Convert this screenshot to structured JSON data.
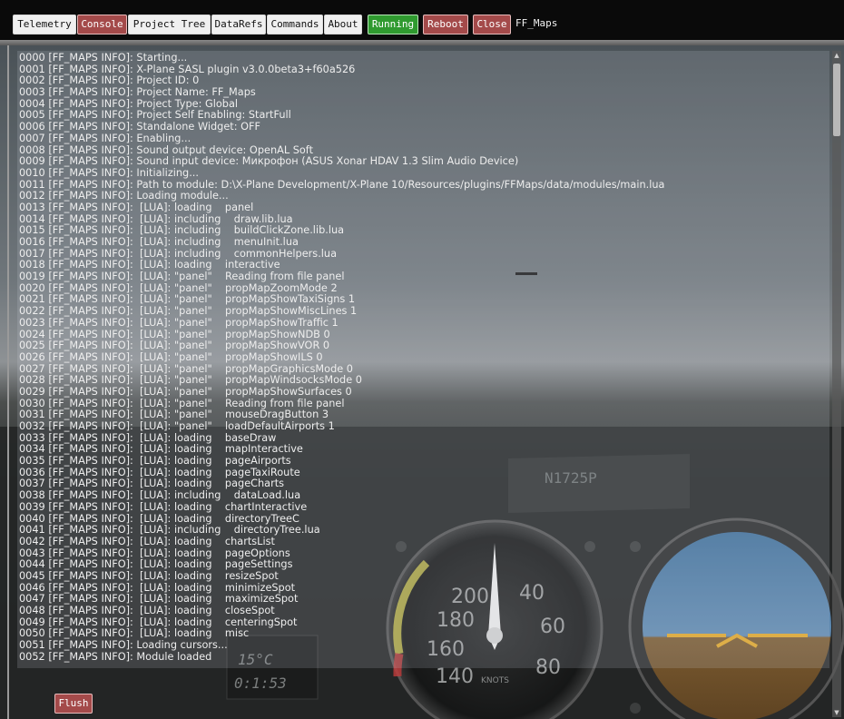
{
  "toolbar": {
    "tabs": [
      "Telemetry",
      "Console",
      "Project Tree",
      "DataRefs",
      "Commands",
      "About"
    ],
    "active_tab": "Console",
    "running_label": "Running",
    "reboot_label": "Reboot",
    "close_label": "Close",
    "plugin_name": "FF_Maps"
  },
  "console": {
    "flush_label": "Flush",
    "lines": [
      "0000 [FF_MAPS INFO]: Starting...",
      "0001 [FF_MAPS INFO]: X-Plane SASL plugin v3.0.0beta3+f60a526",
      "0002 [FF_MAPS INFO]: Project ID: 0",
      "0003 [FF_MAPS INFO]: Project Name: FF_Maps",
      "0004 [FF_MAPS INFO]: Project Type: Global",
      "0005 [FF_MAPS INFO]: Project Self Enabling: StartFull",
      "0006 [FF_MAPS INFO]: Standalone Widget: OFF",
      "0007 [FF_MAPS INFO]: Enabling...",
      "0008 [FF_MAPS INFO]: Sound output device: OpenAL Soft",
      "0009 [FF_MAPS INFO]: Sound input device: Микрофон (ASUS Xonar HDAV 1.3 Slim Audio Device)",
      "0010 [FF_MAPS INFO]: Initializing...",
      "0011 [FF_MAPS INFO]: Path to module: D:\\X-Plane Development/X-Plane 10/Resources/plugins/FFMaps/data/modules/main.lua",
      "0012 [FF_MAPS INFO]: Loading module...",
      "0013 [FF_MAPS INFO]:  [LUA]: loading    panel",
      "0014 [FF_MAPS INFO]:  [LUA]: including    draw.lib.lua",
      "0015 [FF_MAPS INFO]:  [LUA]: including    buildClickZone.lib.lua",
      "0016 [FF_MAPS INFO]:  [LUA]: including    menuInit.lua",
      "0017 [FF_MAPS INFO]:  [LUA]: including    commonHelpers.lua",
      "0018 [FF_MAPS INFO]:  [LUA]: loading    interactive",
      "0019 [FF_MAPS INFO]:  [LUA]: \"panel\"    Reading from file panel",
      "0020 [FF_MAPS INFO]:  [LUA]: \"panel\"    propMapZoomMode 2",
      "0021 [FF_MAPS INFO]:  [LUA]: \"panel\"    propMapShowTaxiSigns 1",
      "0022 [FF_MAPS INFO]:  [LUA]: \"panel\"    propMapShowMiscLines 1",
      "0023 [FF_MAPS INFO]:  [LUA]: \"panel\"    propMapShowTraffic 1",
      "0024 [FF_MAPS INFO]:  [LUA]: \"panel\"    propMapShowNDB 0",
      "0025 [FF_MAPS INFO]:  [LUA]: \"panel\"    propMapShowVOR 0",
      "0026 [FF_MAPS INFO]:  [LUA]: \"panel\"    propMapShowILS 0",
      "0027 [FF_MAPS INFO]:  [LUA]: \"panel\"    propMapGraphicsMode 0",
      "0028 [FF_MAPS INFO]:  [LUA]: \"panel\"    propMapWindsocksMode 0",
      "0029 [FF_MAPS INFO]:  [LUA]: \"panel\"    propMapShowSurfaces 0",
      "0030 [FF_MAPS INFO]:  [LUA]: \"panel\"    Reading from file panel",
      "0031 [FF_MAPS INFO]:  [LUA]: \"panel\"    mouseDragButton 3",
      "0032 [FF_MAPS INFO]:  [LUA]: \"panel\"    loadDefaultAirports 1",
      "0033 [FF_MAPS INFO]:  [LUA]: loading    baseDraw",
      "0034 [FF_MAPS INFO]:  [LUA]: loading    mapInteractive",
      "0035 [FF_MAPS INFO]:  [LUA]: loading    pageAirports",
      "0036 [FF_MAPS INFO]:  [LUA]: loading    pageTaxiRoute",
      "0037 [FF_MAPS INFO]:  [LUA]: loading    pageCharts",
      "0038 [FF_MAPS INFO]:  [LUA]: including    dataLoad.lua",
      "0039 [FF_MAPS INFO]:  [LUA]: loading    chartInteractive",
      "0040 [FF_MAPS INFO]:  [LUA]: loading    directoryTreeC",
      "0041 [FF_MAPS INFO]:  [LUA]: including    directoryTree.lua",
      "0042 [FF_MAPS INFO]:  [LUA]: loading    chartsList",
      "0043 [FF_MAPS INFO]:  [LUA]: loading    pageOptions",
      "0044 [FF_MAPS INFO]:  [LUA]: loading    pageSettings",
      "0045 [FF_MAPS INFO]:  [LUA]: loading    resizeSpot",
      "0046 [FF_MAPS INFO]:  [LUA]: loading    minimizeSpot",
      "0047 [FF_MAPS INFO]:  [LUA]: loading    maximizeSpot",
      "0048 [FF_MAPS INFO]:  [LUA]: loading    closeSpot",
      "0049 [FF_MAPS INFO]:  [LUA]: loading    centeringSpot",
      "0050 [FF_MAPS INFO]:  [LUA]: loading    misc",
      "0051 [FF_MAPS INFO]: Loading cursors...",
      "0052 [FF_MAPS INFO]: Module loaded"
    ]
  },
  "background": {
    "tail_number": "N1725P",
    "temperature": "15°C",
    "clock": "0:1:53",
    "airspeed_unit": "KNOTS",
    "airspeed_ticks": [
      "200",
      "180",
      "160",
      "140",
      "40",
      "60",
      "80"
    ]
  }
}
